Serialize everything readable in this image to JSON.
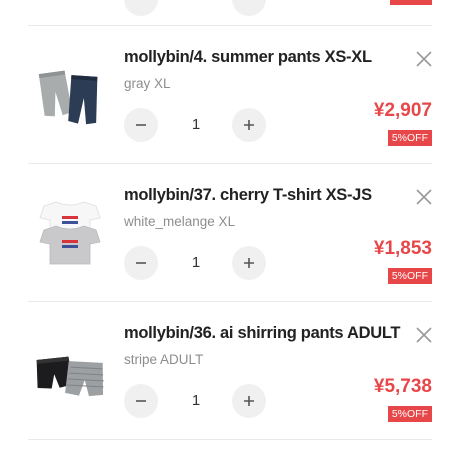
{
  "theme": {
    "accent": "#e8474a",
    "stepper_bg": "#f0f0f0",
    "muted": "#8d8d8d"
  },
  "cart": {
    "items": [
      {
        "title": "mollybin/4. summer pants XS-XL",
        "variant": "gray XL",
        "quantity": "1",
        "price": "¥2,907",
        "discount": "5%OFF",
        "thumbnail": "gray-and-navy-pants-image"
      },
      {
        "title": "mollybin/37. cherry T-shirt XS-JS",
        "variant": "white_melange XL",
        "quantity": "1",
        "price": "¥1,853",
        "discount": "5%OFF",
        "thumbnail": "white-and-gray-cherry-tshirt-image"
      },
      {
        "title": "mollybin/36. ai shirring pants ADULT",
        "variant": "stripe ADULT",
        "quantity": "1",
        "price": "¥5,738",
        "discount": "5%OFF",
        "thumbnail": "black-and-stripe-shorts-image"
      }
    ],
    "icons": {
      "remove": "close-icon",
      "decrease": "minus-icon",
      "increase": "plus-icon"
    }
  }
}
